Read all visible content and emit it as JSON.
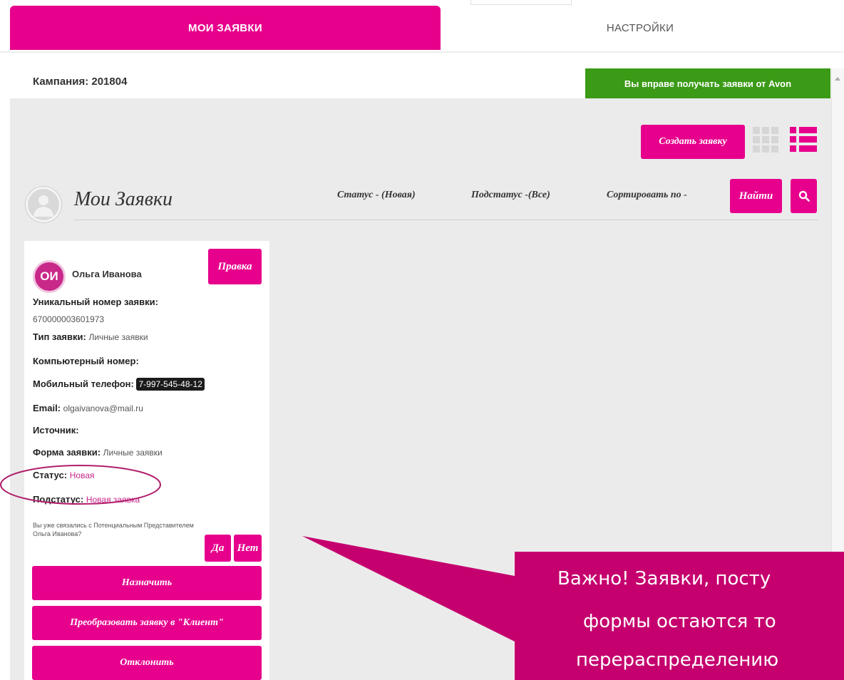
{
  "tabs": [
    {
      "label": "МОИ ЗАЯВКИ",
      "active": true
    },
    {
      "label": "НАСТРОЙКИ",
      "active": false
    }
  ],
  "campaign": {
    "text": "Кампания: 201804"
  },
  "avon_badge": {
    "text": "Вы вправе получать заявки от Avon"
  },
  "toolbar": {
    "create_label": "Создать заявку"
  },
  "heading": {
    "title": "Мои Заявки",
    "status_filter": "Статус - (Новая)",
    "substatus_filter": "Подстатус -(Все)",
    "sort_filter": "Сортировать по -",
    "find_label": "Найти"
  },
  "card": {
    "initials": "ОИ",
    "name": "Ольга Иванова",
    "edit_label": "Правка",
    "unique_number_label": "Уникальный номер заявки:",
    "unique_number_value": "670000003601973",
    "type_label": "Тип заявки:",
    "type_value": "Личные заявки",
    "computer_number_label": "Компьютерный номер:",
    "mobile_label": "Мобильный телефон:",
    "mobile_value": "7-997-545-48-12",
    "email_label": "Email:",
    "email_value": "olgaivanova@mail.ru",
    "source_label": "Источник:",
    "form_label": "Форма заявки:",
    "form_value": "Личные заявки",
    "status_label": "Статус:",
    "status_value": "Новая",
    "substatus_label": "Подстатус:",
    "substatus_value": "Новая заявка",
    "question": "Вы уже связались с Потенциальным Представителем Ольга Иванова?",
    "yes_label": "Да",
    "no_label": "Нет",
    "assign_label": "Назначить",
    "convert_label": "Преобразовать заявку в \"Клиент\"",
    "decline_label": "Отклонить"
  },
  "banner": {
    "line1": "Важно! Заявки, посту",
    "line2": "формы остаются то",
    "line3": "перераспределению"
  },
  "colors": {
    "accent": "#e6008c",
    "badge_green": "#3b9a16",
    "banner": "#c5006e"
  }
}
